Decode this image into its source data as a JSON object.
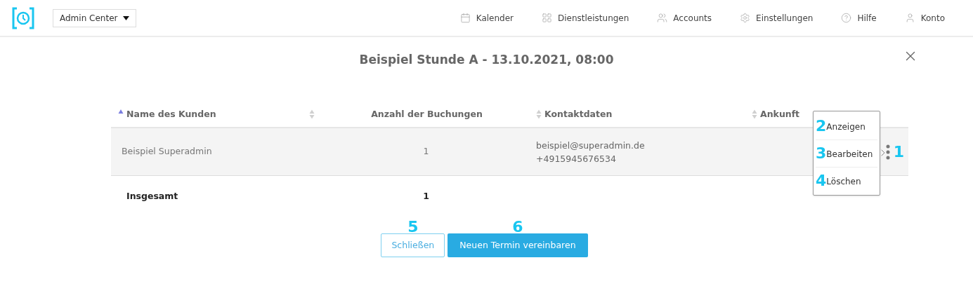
{
  "header": {
    "center_select": "Admin Center",
    "nav": [
      {
        "label": "Kalender"
      },
      {
        "label": "Dienstleistungen"
      },
      {
        "label": "Accounts"
      },
      {
        "label": "Einstellungen"
      },
      {
        "label": "Hilfe"
      },
      {
        "label": "Konto"
      }
    ]
  },
  "dialog": {
    "title": "Beispiel Stunde A - 13.10.2021, 08:00",
    "table": {
      "columns": [
        {
          "label": "Name des Kunden",
          "sorted": true
        },
        {
          "label": "Anzahl der Buchungen",
          "sorted": false
        },
        {
          "label": "Kontaktdaten",
          "sorted": false
        },
        {
          "label": "Ankunft",
          "sorted": false
        }
      ],
      "rows": [
        {
          "name": "Beispiel Superadmin",
          "count": "1",
          "contact": [
            "beispiel@superadmin.de",
            "+4915945676534"
          ],
          "menu_callout": "1"
        }
      ],
      "total": {
        "label": "Insgesamt",
        "count": "1"
      }
    },
    "row_menu": [
      {
        "callout": "2",
        "label": "Anzeigen"
      },
      {
        "callout": "3",
        "label": "Bearbeiten"
      },
      {
        "callout": "4",
        "label": "Löschen"
      }
    ],
    "buttons": [
      {
        "kind": "secondary",
        "callout": "5",
        "label": "Schließen"
      },
      {
        "kind": "primary",
        "callout": "6",
        "label": "Neuen Termin vereinbaren"
      }
    ]
  }
}
